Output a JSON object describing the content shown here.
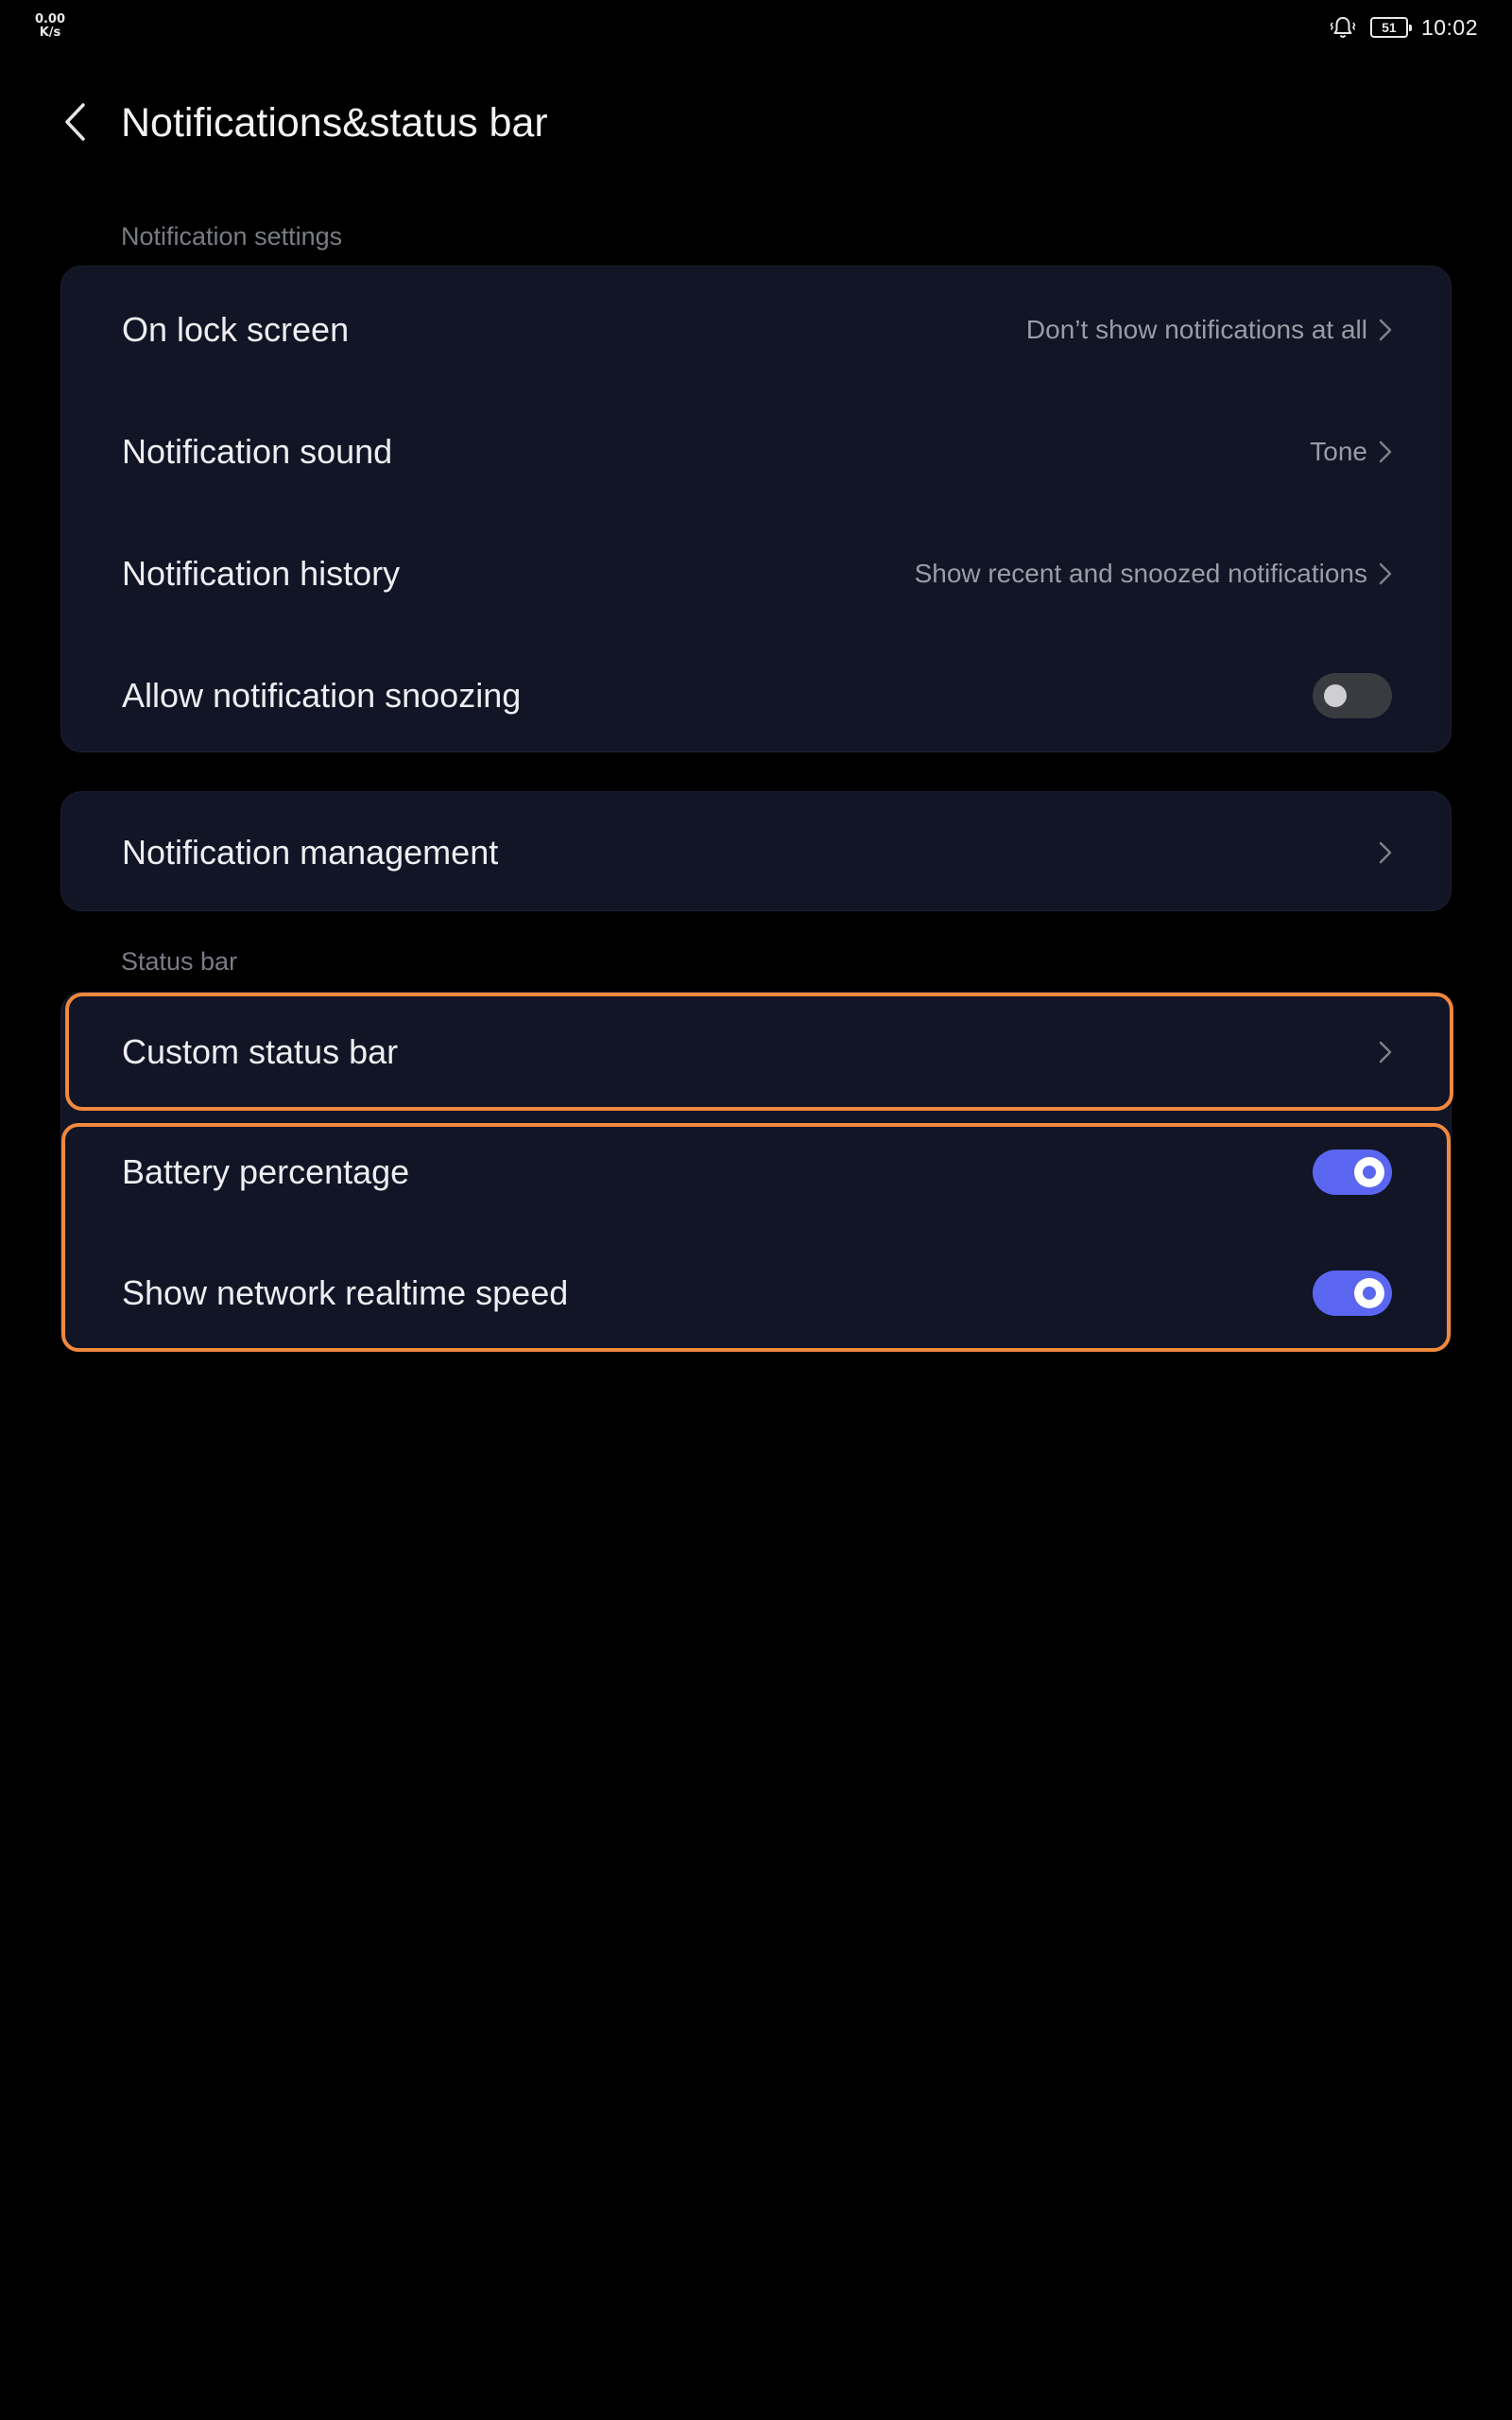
{
  "status_bar": {
    "net_speed_value": "0.00",
    "net_speed_unit": "K/s",
    "bell_icon": "vibrate-bell-icon",
    "battery_level": "51",
    "time": "10:02"
  },
  "header": {
    "back_icon": "back-arrow-icon",
    "title": "Notifications&status bar"
  },
  "sections": {
    "notification_settings_label": "Notification settings",
    "status_bar_label": "Status bar"
  },
  "notification_settings": {
    "lock_screen": {
      "label": "On lock screen",
      "value": "Don’t show notifications at all"
    },
    "sound": {
      "label": "Notification sound",
      "value": "Tone"
    },
    "history": {
      "label": "Notification history",
      "value": "Show recent and snoozed notifications"
    },
    "snoozing": {
      "label": "Allow notification snoozing",
      "enabled": false
    }
  },
  "management": {
    "label": "Notification management"
  },
  "status_bar_settings": {
    "custom": {
      "label": "Custom status bar"
    },
    "battery_percentage": {
      "label": "Battery percentage",
      "enabled": true
    },
    "network_speed": {
      "label": "Show network realtime speed",
      "enabled": true
    }
  },
  "colors": {
    "background": "#000000",
    "card": "#111525",
    "accent": "#5B66F0",
    "highlight": "#F0883E",
    "toggle_off": "#3A3B40"
  }
}
